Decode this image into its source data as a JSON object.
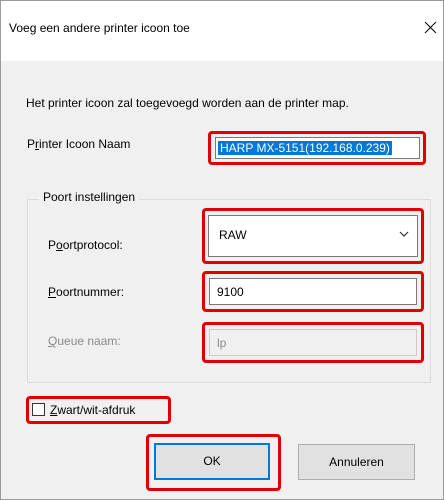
{
  "dialog": {
    "title": "Voeg een andere printer icoon toe",
    "description": "Het printer icoon zal toegevoegd worden aan de printer map."
  },
  "printer_name": {
    "label_pre": "P",
    "label_accel": "r",
    "label_post": "inter Icoon Naam",
    "value": "HARP MX-5151(192.168.0.239)"
  },
  "port_settings": {
    "group_title": "Poort instellingen",
    "protocol": {
      "label_pre": "P",
      "label_accel": "o",
      "label_post": "ortprotocol:",
      "value": "RAW"
    },
    "port_number": {
      "label_accel": "P",
      "label_post": "oortnummer:",
      "value": "9100"
    },
    "queue": {
      "label_accel": "Q",
      "label_post": "ueue naam:",
      "value": "lp"
    }
  },
  "monochrome": {
    "label_accel": "Z",
    "label_post": "wart/wit-afdruk",
    "checked": false
  },
  "buttons": {
    "ok": "OK",
    "cancel": "Annuleren"
  },
  "colors": {
    "highlight": "#e00000",
    "selection": "#0078d7",
    "dialog_bg": "#f0f0f0"
  }
}
